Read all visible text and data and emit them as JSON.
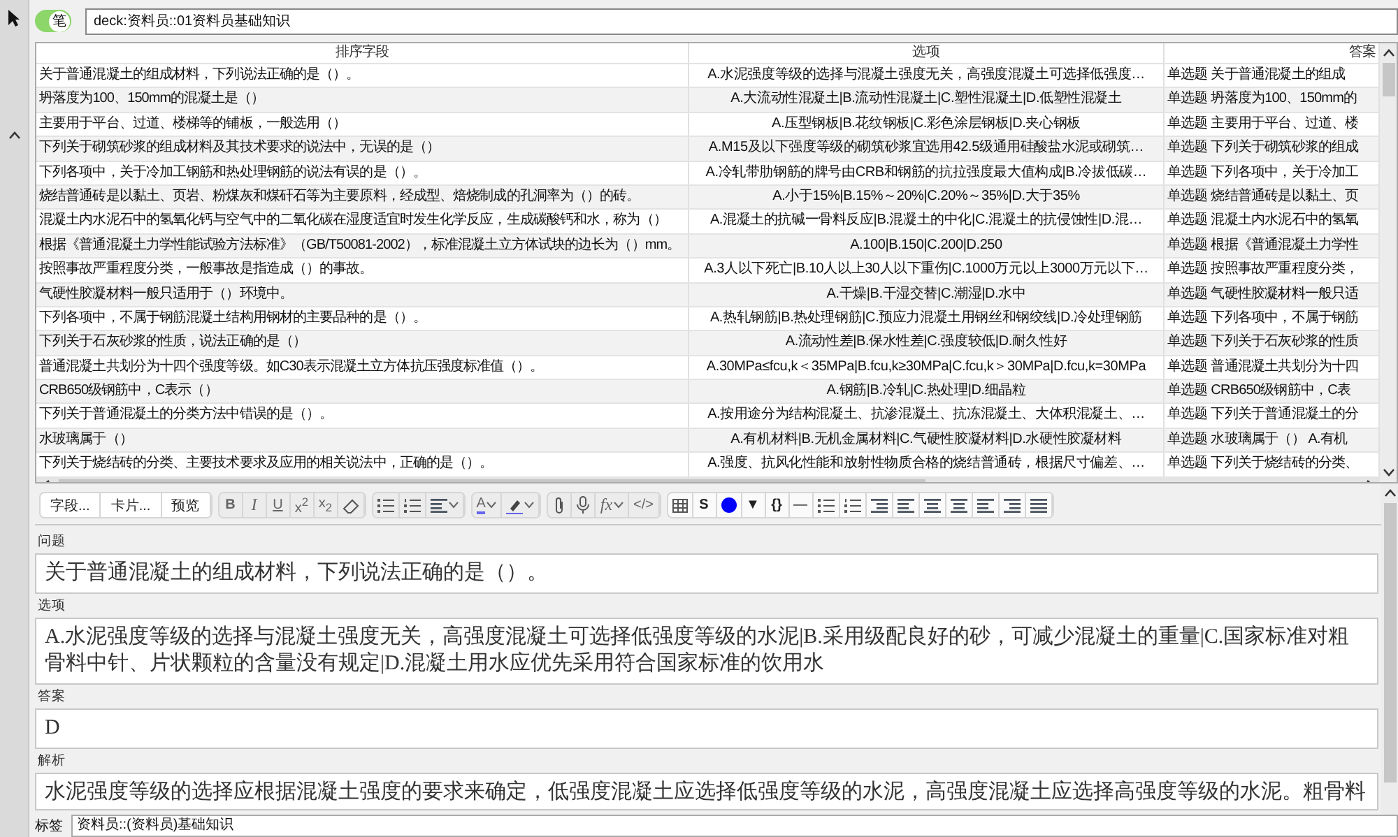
{
  "search": {
    "toggle": {
      "label": "笔",
      "on": true
    },
    "value": "deck:资料员::01资料员基础知识"
  },
  "table": {
    "columns": [
      "排序字段",
      "选项",
      "答案"
    ],
    "rows": [
      {
        "cells": [
          "关于普通混凝土的组成材料，下列说法正确的是（）。",
          "A.水泥强度等级的选择与混凝土强度无关，高强度混凝土可选择低强度…",
          "单选题 关于普通混凝土的组成"
        ]
      },
      {
        "cells": [
          "坍落度为100、150mm的混凝土是（）",
          "A.大流动性混凝土|B.流动性混凝土|C.塑性混凝土|D.低塑性混凝土",
          "单选题 坍落度为100、150mm的"
        ]
      },
      {
        "cells": [
          "主要用于平台、过道、楼梯等的铺板，一般选用（）",
          "A.压型钢板|B.花纹钢板|C.彩色涂层钢板|D.夹心钢板",
          "单选题 主要用于平台、过道、楼"
        ]
      },
      {
        "cells": [
          "下列关于砌筑砂浆的组成材料及其技术要求的说法中，无误的是（）",
          "A.M15及以下强度等级的砌筑砂浆宜选用42.5级通用硅酸盐水泥或砌筑…",
          "单选题 下列关于砌筑砂浆的组成"
        ]
      },
      {
        "cells": [
          "下列各项中，关于冷加工钢筋和热处理钢筋的说法有误的是（）。",
          "A.冷轧带肋钢筋的牌号由CRB和钢筋的抗拉强度最大值构成|B.冷拔低碳…",
          "单选题 下列各项中，关于冷加工"
        ]
      },
      {
        "cells": [
          "烧结普通砖是以黏土、页岩、粉煤灰和煤矸石等为主要原料，经成型、焙烧制成的孔洞率为（）的砖。",
          "A.小于15%|B.15%～20%|C.20%～35%|D.大于35%",
          "单选题 烧结普通砖是以黏土、页"
        ]
      },
      {
        "cells": [
          "混凝土内水泥石中的氢氧化钙与空气中的二氧化碳在湿度适宜时发生化学反应，生成碳酸钙和水，称为（）",
          "A.混凝土的抗碱一骨料反应|B.混凝土的中化|C.混凝土的抗侵蚀性|D.混…",
          "单选题 混凝土内水泥石中的氢氧"
        ]
      },
      {
        "cells": [
          "根据《普通混凝土力学性能试验方法标准》（GB/T50081-2002），标准混凝土立方体试块的边长为（）mm。",
          "A.100|B.150|C.200|D.250",
          "单选题 根据《普通混凝土力学性"
        ]
      },
      {
        "cells": [
          "按照事故严重程度分类，一般事故是指造成（）的事故。",
          "A.3人以下死亡|B.10人以上30人以下重伤|C.1000万元以上3000万元以下…",
          "单选题 按照事故严重程度分类，"
        ]
      },
      {
        "cells": [
          "气硬性胶凝材料一般只适用于（）环境中。",
          "A.干燥|B.干湿交替|C.潮湿|D.水中",
          "单选题 气硬性胶凝材料一般只适"
        ]
      },
      {
        "cells": [
          "下列各项中，不属于钢筋混凝土结构用钢材的主要品种的是（）。",
          "A.热轧钢筋|B.热处理钢筋|C.预应力混凝土用钢丝和钢绞线|D.冷处理钢筋",
          "单选题 下列各项中，不属于钢筋"
        ]
      },
      {
        "cells": [
          "下列关于石灰砂浆的性质，说法正确的是（）",
          "A.流动性差|B.保水性差|C.强度较低|D.耐久性好",
          "单选题 下列关于石灰砂浆的性质"
        ]
      },
      {
        "cells": [
          "普通混凝土共划分为十四个强度等级。如C30表示混凝土立方体抗压强度标准值（）。",
          "A.30MPa≤fcu,k＜35MPa|B.fcu,k≥30MPa|C.fcu,k＞30MPa|D.fcu,k=30MPa",
          "单选题 普通混凝土共划分为十四"
        ]
      },
      {
        "cells": [
          "CRB650级钢筋中，C表示（）",
          "A.钢筋|B.冷轧|C.热处理|D.细晶粒",
          "单选题 CRB650级钢筋中，C表"
        ]
      },
      {
        "cells": [
          "下列关于普通混凝土的分类方法中错误的是（）。",
          "A.按用途分为结构混凝土、抗渗混凝土、抗冻混凝土、大体积混凝土、…",
          "单选题 下列关于普通混凝土的分"
        ]
      },
      {
        "cells": [
          "水玻璃属于（）",
          "A.有机材料|B.无机金属材料|C.气硬性胶凝材料|D.水硬性胶凝材料",
          "单选题 水玻璃属于（） A.有机"
        ]
      },
      {
        "cells": [
          "下列关于烧结砖的分类、主要技术要求及应用的相关说法中，正确的是（）。",
          "A.强度、抗风化性能和放射性物质合格的烧结普通砖，根据尺寸偏差、…",
          "单选题 下列关于烧结砖的分类、"
        ]
      }
    ]
  },
  "editor": {
    "buttons": [
      "字段...",
      "卡片...",
      "预览"
    ],
    "tool_groups": [
      [
        {
          "kind": "bold",
          "label": "B"
        },
        {
          "kind": "italic",
          "label": "I"
        },
        {
          "kind": "underline",
          "label": "U"
        },
        {
          "kind": "text",
          "label": "x$^{2}$"
        },
        {
          "kind": "text",
          "label": "x$_{2}$"
        },
        {
          "kind": "eraser"
        }
      ],
      [
        {
          "kind": "bullets"
        },
        {
          "kind": "numbers"
        },
        {
          "kind": "align",
          "caret": true
        }
      ],
      [
        {
          "kind": "text-color",
          "label": "A",
          "caret": true
        },
        {
          "kind": "highlight",
          "caret": true
        }
      ],
      [
        {
          "kind": "clip"
        },
        {
          "kind": "mic"
        },
        {
          "kind": "italic",
          "label": "fx",
          "caret": true
        },
        {
          "kind": "text",
          "label": "</>"
        }
      ],
      [
        {
          "kind": "table"
        },
        {
          "kind": "strike",
          "label": "S"
        },
        {
          "kind": "dot",
          "color": "#0000ff"
        },
        {
          "kind": "text",
          "label": "▼"
        },
        {
          "kind": "bold",
          "label": "{}"
        },
        {
          "kind": "text",
          "label": "—"
        },
        {
          "kind": "bullets"
        },
        {
          "kind": "numbers"
        },
        {
          "kind": "indent"
        },
        {
          "kind": "outdent"
        },
        {
          "kind": "center"
        },
        {
          "kind": "center"
        },
        {
          "kind": "left"
        },
        {
          "kind": "right"
        },
        {
          "kind": "justify"
        }
      ]
    ],
    "fields": [
      {
        "label": "问题",
        "value": "关于普通混凝土的组成材料，下列说法正确的是（）。"
      },
      {
        "label": "选项",
        "value": "A.水泥强度等级的选择与混凝土强度无关，高强度混凝土可选择低强度等级的水泥|B.采用级配良好的砂，可减少混凝土的重量|C.国家标准对粗骨料中针、片状颗粒的含量没有规定|D.混凝土用水应优先采用符合国家标准的饮用水"
      },
      {
        "label": "答案",
        "value": "D"
      },
      {
        "label": "解析",
        "value": "水泥强度等级的选择应根据混凝土强度的要求来确定，低强度混凝土应选择低强度等级的水泥，高强度混凝土应选择高强度等级的水泥。粗骨料"
      }
    ],
    "tags": {
      "label": "标签",
      "value": "资料员::(资料员)基础知识"
    }
  }
}
